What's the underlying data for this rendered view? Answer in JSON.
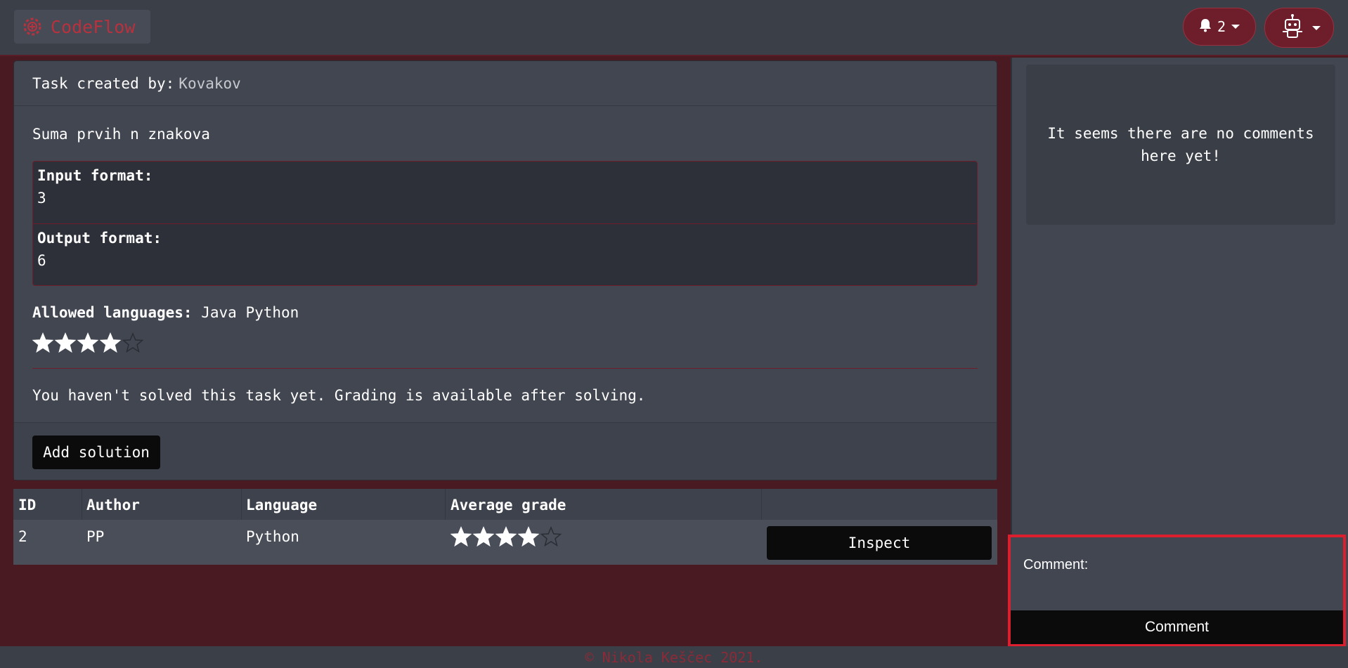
{
  "navbar": {
    "brand": "CodeFlow",
    "notifications_count": "2",
    "brand_logo_icon": "gear-brain-icon",
    "bell_icon": "bell-icon",
    "avatar_icon": "robot-avatar-icon"
  },
  "task": {
    "created_by_label": "Task created by:",
    "creator": "Kovakov",
    "name": "Suma prvih n znakova",
    "input_label": "Input format:",
    "input_value": "3",
    "output_label": "Output format:",
    "output_value": "6",
    "languages_label": "Allowed languages:",
    "languages": "Java Python",
    "rating": 4,
    "rating_max": 5,
    "notice": "You haven't solved this task yet. Grading is available after solving.",
    "add_solution_label": "Add solution"
  },
  "solutions": {
    "headers": [
      "ID",
      "Author",
      "Language",
      "Average grade",
      ""
    ],
    "rows": [
      {
        "id": "2",
        "author": "PP",
        "language": "Python",
        "grade": 4,
        "action": "Inspect"
      }
    ]
  },
  "comments": {
    "empty_message": "It seems there are no comments here yet!",
    "comment_label": "Comment:",
    "comment_button": "Comment"
  },
  "footer": {
    "copyright": "© Nikola Keščec 2021."
  },
  "colors": {
    "background": "#4a1a23",
    "panel": "#424651",
    "accent": "#b8313f",
    "highlight_border": "#dc1f2e"
  }
}
